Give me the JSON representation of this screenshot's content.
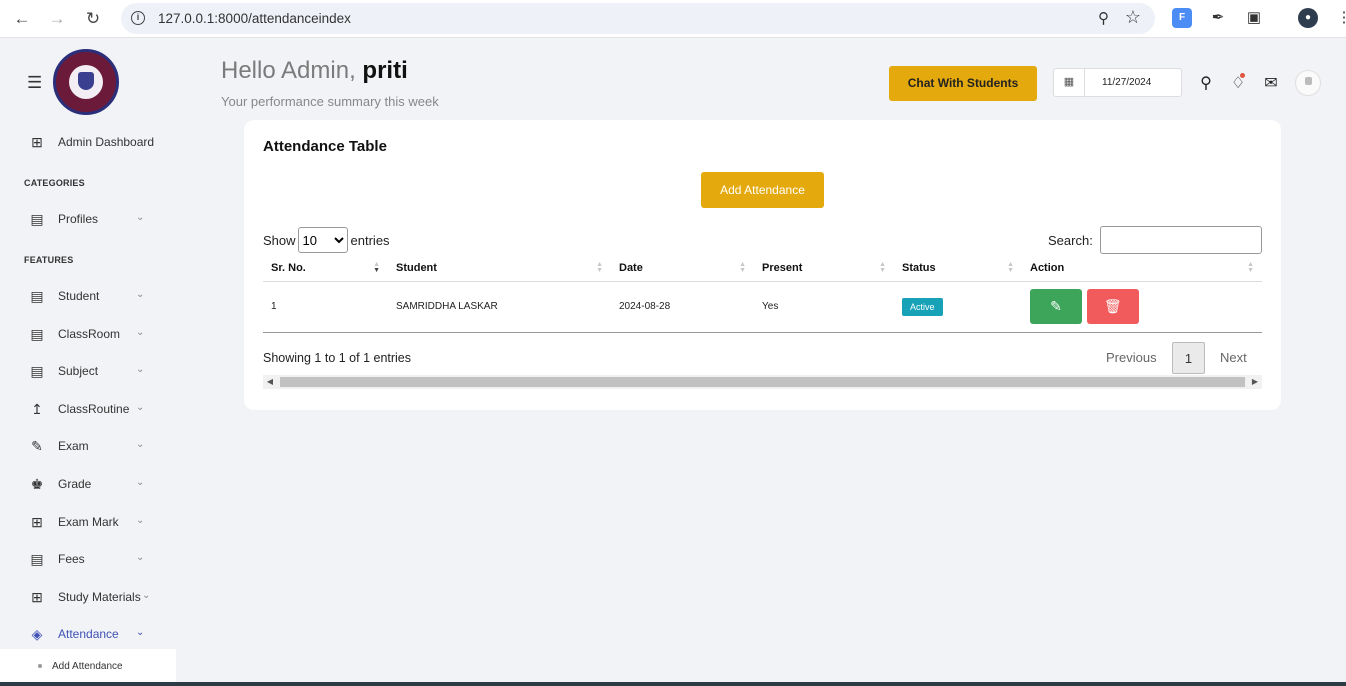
{
  "browser": {
    "url": "127.0.0.1:8000/attendanceindex",
    "ext_label": "F"
  },
  "header": {
    "greeting_prefix": "Hello Admin, ",
    "user_name": "priti",
    "subtitle": "Your performance summary this week",
    "chat_button": "Chat With Students",
    "date": "11/27/2024"
  },
  "sidebar": {
    "dashboard": "Admin Dashboard",
    "categories_heading": "CATEGORIES",
    "features_heading": "FEATURES",
    "items": [
      {
        "label": "Profiles"
      },
      {
        "label": "Student"
      },
      {
        "label": "ClassRoom"
      },
      {
        "label": "Subject"
      },
      {
        "label": "ClassRoutine"
      },
      {
        "label": "Exam"
      },
      {
        "label": "Grade"
      },
      {
        "label": "Exam Mark"
      },
      {
        "label": "Fees"
      },
      {
        "label": "Study Materials"
      },
      {
        "label": "Attendance"
      }
    ],
    "submenu_item": "Add Attendance"
  },
  "card": {
    "title": "Attendance Table",
    "add_button": "Add Attendance",
    "show_label": "Show",
    "entries_label": "entries",
    "page_size": "10",
    "search_label": "Search:",
    "columns": [
      "Sr. No.",
      "Student",
      "Date",
      "Present",
      "Status",
      "Action"
    ],
    "rows": [
      {
        "sr": "1",
        "student": "SAMRIDDHA LASKAR",
        "date": "2024-08-28",
        "present": "Yes",
        "status": "Active"
      }
    ],
    "info": "Showing 1 to 1 of 1 entries",
    "prev": "Previous",
    "current_page": "1",
    "next": "Next"
  },
  "colors": {
    "accent": "#e4a90d",
    "active_nav": "#3f51b5",
    "status_badge": "#17a2b8",
    "edit_button": "#3da55a",
    "delete_button": "#f15b5b"
  }
}
